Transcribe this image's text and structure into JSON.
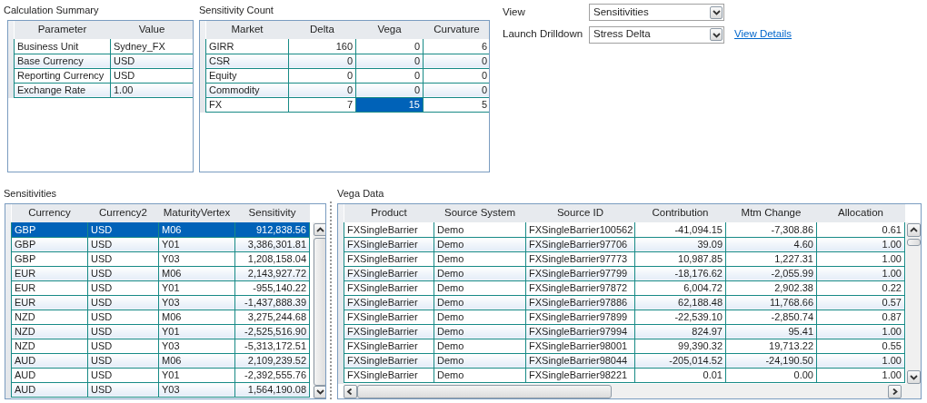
{
  "calculation_summary": {
    "title": "Calculation Summary",
    "columns": [
      "Parameter",
      "Value"
    ],
    "rows": [
      [
        "Business Unit",
        "Sydney_FX"
      ],
      [
        "Base Currency",
        "USD"
      ],
      [
        "Reporting Currency",
        "USD"
      ],
      [
        "Exchange Rate",
        "1.00"
      ]
    ]
  },
  "sensitivity_count": {
    "title": "Sensitivity Count",
    "columns": [
      "Market",
      "Delta",
      "Vega",
      "Curvature"
    ],
    "rows": [
      {
        "cells": [
          {
            "text": "GIRR",
            "selected": false
          },
          {
            "text": "160",
            "selected": false
          },
          {
            "text": "0",
            "selected": false
          },
          {
            "text": "6",
            "selected": false
          }
        ]
      },
      {
        "cells": [
          {
            "text": "CSR",
            "selected": false
          },
          {
            "text": "0",
            "selected": false
          },
          {
            "text": "0",
            "selected": false
          },
          {
            "text": "0",
            "selected": false
          }
        ]
      },
      {
        "cells": [
          {
            "text": "Equity",
            "selected": false
          },
          {
            "text": "0",
            "selected": false
          },
          {
            "text": "0",
            "selected": false
          },
          {
            "text": "0",
            "selected": false
          }
        ]
      },
      {
        "cells": [
          {
            "text": "Commodity",
            "selected": false
          },
          {
            "text": "0",
            "selected": false
          },
          {
            "text": "0",
            "selected": false
          },
          {
            "text": "0",
            "selected": false
          }
        ]
      },
      {
        "cells": [
          {
            "text": "FX",
            "selected": false
          },
          {
            "text": "7",
            "selected": false
          },
          {
            "text": "15",
            "selected": true
          },
          {
            "text": "5",
            "selected": false
          }
        ]
      }
    ]
  },
  "view": {
    "label": "View",
    "value": "Sensitivities"
  },
  "launch_drilldown": {
    "label": "Launch Drilldown",
    "value": "Stress Delta",
    "link": "View Details"
  },
  "sensitivities": {
    "title": "Sensitivities",
    "columns": [
      "Currency",
      "Currency2",
      "MaturityVertex",
      "Sensitivity"
    ],
    "rows": [
      {
        "cells": [
          "GBP",
          "USD",
          "M06",
          "912,838.56"
        ],
        "selected": true
      },
      {
        "cells": [
          "GBP",
          "USD",
          "Y01",
          "3,386,301.81"
        ],
        "selected": false
      },
      {
        "cells": [
          "GBP",
          "USD",
          "Y03",
          "1,208,158.04"
        ],
        "selected": false
      },
      {
        "cells": [
          "EUR",
          "USD",
          "M06",
          "2,143,927.72"
        ],
        "selected": false
      },
      {
        "cells": [
          "EUR",
          "USD",
          "Y01",
          "-955,140.22"
        ],
        "selected": false
      },
      {
        "cells": [
          "EUR",
          "USD",
          "Y03",
          "-1,437,888.39"
        ],
        "selected": false
      },
      {
        "cells": [
          "NZD",
          "USD",
          "M06",
          "3,275,244.68"
        ],
        "selected": false
      },
      {
        "cells": [
          "NZD",
          "USD",
          "Y01",
          "-2,525,516.90"
        ],
        "selected": false
      },
      {
        "cells": [
          "NZD",
          "USD",
          "Y03",
          "-5,313,172.51"
        ],
        "selected": false
      },
      {
        "cells": [
          "AUD",
          "USD",
          "M06",
          "2,109,239.52"
        ],
        "selected": false
      },
      {
        "cells": [
          "AUD",
          "USD",
          "Y01",
          "-2,392,555.76"
        ],
        "selected": false
      },
      {
        "cells": [
          "AUD",
          "USD",
          "Y03",
          "1,564,190.08"
        ],
        "selected": false
      }
    ]
  },
  "vega_data": {
    "title": "Vega Data",
    "columns": [
      "Product",
      "Source System",
      "Source ID",
      "Contribution",
      "Mtm Change",
      "Allocation"
    ],
    "rows": [
      [
        "FXSingleBarrier",
        "Demo",
        "FXSingleBarrier100562",
        "-41,094.15",
        "-7,308.86",
        "0.61"
      ],
      [
        "FXSingleBarrier",
        "Demo",
        "FXSingleBarrier97706",
        "39.09",
        "4.60",
        "1.00"
      ],
      [
        "FXSingleBarrier",
        "Demo",
        "FXSingleBarrier97773",
        "10,987.85",
        "1,227.31",
        "1.00"
      ],
      [
        "FXSingleBarrier",
        "Demo",
        "FXSingleBarrier97799",
        "-18,176.62",
        "-2,055.99",
        "1.00"
      ],
      [
        "FXSingleBarrier",
        "Demo",
        "FXSingleBarrier97872",
        "6,004.72",
        "2,902.38",
        "0.22"
      ],
      [
        "FXSingleBarrier",
        "Demo",
        "FXSingleBarrier97886",
        "62,188.48",
        "11,768.66",
        "0.57"
      ],
      [
        "FXSingleBarrier",
        "Demo",
        "FXSingleBarrier97899",
        "-22,539.10",
        "-2,850.74",
        "0.87"
      ],
      [
        "FXSingleBarrier",
        "Demo",
        "FXSingleBarrier97994",
        "824.97",
        "95.41",
        "1.00"
      ],
      [
        "FXSingleBarrier",
        "Demo",
        "FXSingleBarrier98001",
        "99,390.32",
        "19,713.22",
        "0.55"
      ],
      [
        "FXSingleBarrier",
        "Demo",
        "FXSingleBarrier98044",
        "-205,014.52",
        "-24,190.50",
        "1.00"
      ],
      [
        "FXSingleBarrier",
        "Demo",
        "FXSingleBarrier98221",
        "0.01",
        "0.00",
        "1.00"
      ]
    ]
  }
}
